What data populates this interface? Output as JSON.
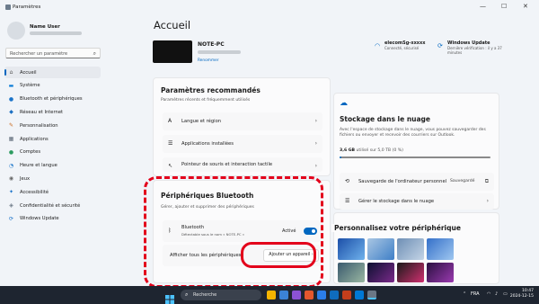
{
  "window": {
    "title": "Paramètres",
    "minimize": "—",
    "maximize": "☐",
    "close": "✕"
  },
  "user": {
    "name": "Name User"
  },
  "search": {
    "placeholder": "Rechercher un paramètre",
    "icon": "search-icon"
  },
  "sidebar": {
    "items": [
      {
        "label": "Accueil",
        "icon": "home-icon",
        "glyph": "⌂",
        "color": "#555555",
        "selected": true
      },
      {
        "label": "Système",
        "icon": "monitor-icon",
        "glyph": "▬",
        "color": "#0a7bd6"
      },
      {
        "label": "Bluetooth et périphériques",
        "icon": "bluetooth-icon",
        "glyph": "●",
        "color": "#1a73c9"
      },
      {
        "label": "Réseau et Internet",
        "icon": "wifi-icon",
        "glyph": "◆",
        "color": "#1b6fc2"
      },
      {
        "label": "Personnalisation",
        "icon": "brush-icon",
        "glyph": "✎",
        "color": "#c96a1e"
      },
      {
        "label": "Applications",
        "icon": "apps-icon",
        "glyph": "▦",
        "color": "#5b6776"
      },
      {
        "label": "Comptes",
        "icon": "account-icon",
        "glyph": "●",
        "color": "#2b9b5f"
      },
      {
        "label": "Heure et langue",
        "icon": "globe-icon",
        "glyph": "◔",
        "color": "#1b75c8"
      },
      {
        "label": "Jeux",
        "icon": "gamepad-icon",
        "glyph": "◉",
        "color": "#6a6a6a"
      },
      {
        "label": "Accessibilité",
        "icon": "accessibility-icon",
        "glyph": "✦",
        "color": "#1a73c9"
      },
      {
        "label": "Confidentialité et sécurité",
        "icon": "shield-icon",
        "glyph": "◈",
        "color": "#6b7785"
      },
      {
        "label": "Windows Update",
        "icon": "update-icon",
        "glyph": "⟳",
        "color": "#1a73c9"
      }
    ]
  },
  "page": {
    "title": "Accueil"
  },
  "device": {
    "name": "NOTE-PC",
    "rename": "Renommer"
  },
  "status": [
    {
      "title": "elecomSg-xxxxx",
      "sub": "Connecté, sécurisé",
      "icon": "wifi-icon"
    },
    {
      "title": "Windows Update",
      "sub": "Dernière vérification : il y a 37 minutes",
      "icon": "update-icon"
    }
  ],
  "recommended": {
    "title": "Paramètres recommandés",
    "subtitle": "Paramètres récents et fréquemment utilisés",
    "items": [
      {
        "label": "Langue et région",
        "icon": "language-icon"
      },
      {
        "label": "Applications installées",
        "icon": "apps-list-icon"
      },
      {
        "label": "Pointeur de souris et interaction tactile",
        "icon": "pointer-icon"
      }
    ]
  },
  "bluetooth_card": {
    "title": "Périphériques Bluetooth",
    "subtitle": "Gérer, ajouter et supprimer des périphériques",
    "bt_label": "Bluetooth",
    "bt_sub": "Détectable sous le nom « NOTE-PC »",
    "bt_state": "Activé",
    "show_all": "Afficher tous les périphériques",
    "add_device": "Ajouter un appareil"
  },
  "cloud": {
    "title": "Stockage dans le nuage",
    "desc": "Avec l'espace de stockage dans le nuage, vous pouvez sauvegarder des fichiers ou envoyer et recevoir des courriers sur Outlook.",
    "used": "3,6 GB",
    "used_suffix": "utilisé sur 5,0 TB (0 %)",
    "used_fraction": 0.01,
    "backup": "Sauvegarde de l'ordinateur personnel",
    "backup_status": "Sauvegardé",
    "manage": "Gérer le stockage dans le nuage",
    "accent": "#0067c0"
  },
  "personalize": {
    "title": "Personnalisez votre périphérique"
  },
  "taskbar": {
    "search": "Recherche",
    "lang": "FRA",
    "time": "10:47",
    "date": "2024-12-15"
  },
  "colors": {
    "accent": "#0067c0",
    "highlight": "#e3001b"
  }
}
